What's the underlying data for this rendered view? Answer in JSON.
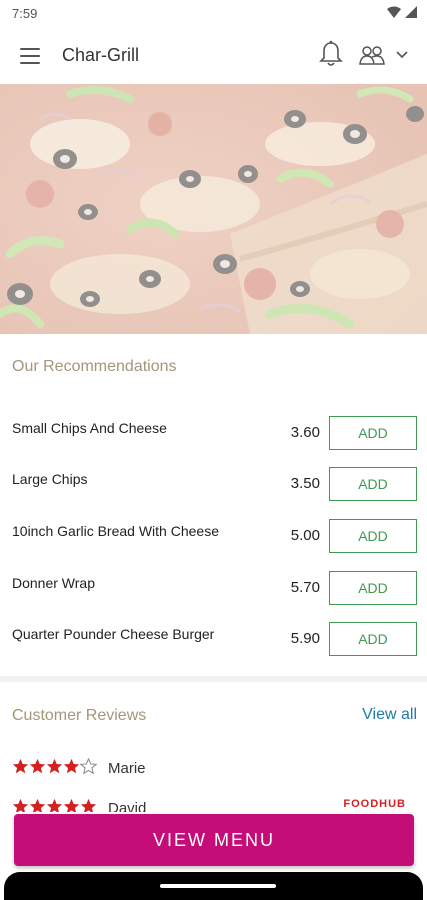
{
  "status_bar": {
    "time": "7:59",
    "icons": [
      "wifi-icon",
      "signal-icon"
    ]
  },
  "app_bar": {
    "title": "Char-Grill",
    "icons": [
      "menu-icon",
      "bell-icon",
      "people-icon",
      "chevron-down-icon"
    ]
  },
  "hero": {
    "image": "pizza-photo"
  },
  "recommendations": {
    "title": "Our Recommendations",
    "items": [
      {
        "name": "Small Chips And Cheese",
        "price": "3.60",
        "button": "ADD"
      },
      {
        "name": "Large Chips",
        "price": "3.50",
        "button": "ADD"
      },
      {
        "name": "10inch Garlic Bread With Cheese",
        "price": "5.00",
        "button": "ADD"
      },
      {
        "name": "Donner Wrap",
        "price": "5.70",
        "button": "ADD"
      },
      {
        "name": "Quarter Pounder Cheese Burger",
        "price": "5.90",
        "button": "ADD"
      }
    ]
  },
  "reviews": {
    "title": "Customer Reviews",
    "view_all": "View all",
    "items": [
      {
        "name": "Marie",
        "rating": 4,
        "max": 5
      },
      {
        "name": "David",
        "rating": 5,
        "max": 5,
        "source": "FOODHUB"
      }
    ]
  },
  "footer": {
    "view_menu": "VIEW MENU"
  },
  "colors": {
    "accent": "#c40d78",
    "add_green": "#3e9a55",
    "section_title": "#a3967a",
    "link": "#1f7ca8",
    "star": "#d32020"
  }
}
